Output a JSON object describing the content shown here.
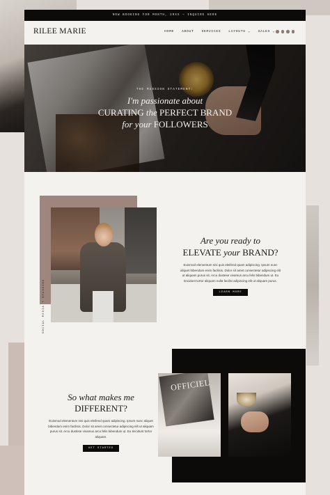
{
  "topbar": {
    "announcement": "NOW BOOKING FOR MONTH, 20XX — INQUIRE HERE"
  },
  "nav": {
    "logo": "RILEE MARIE",
    "items": [
      {
        "label": "HOME"
      },
      {
        "label": "ABOUT"
      },
      {
        "label": "SERVICES"
      },
      {
        "label": "LAYOUTS ⌄"
      },
      {
        "label": "SALES ⌄"
      }
    ],
    "social_icons": [
      "facebook-icon",
      "pinterest-icon",
      "instagram-icon",
      "heart-icon"
    ]
  },
  "hero": {
    "eyebrow": "THE MISSION STATEMENT:",
    "line1": "I'm passionate about",
    "line2_a": "CURATING ",
    "line2_b": "the",
    "line2_c": " PERFECT BRAND",
    "line3_a": "for your",
    "line3_b": " FOLLOWERS"
  },
  "about": {
    "vertical_label": "SOCIAL MEDIA + BRANDING",
    "title_a": "Are you ready to",
    "title_b": "ELEVATE ",
    "title_c": "your",
    "title_d": " BRAND?",
    "body": "Euismod elementum nisi quis eleifend quam adipiscing. Ipsum nunc aliquet bibendum enim facilisis. Dolor sit amet consectetur adipiscing elit ut aliquam purus sit. Arcu dustese vivamus arcu felis bibendum ut. Eu tincidunt tortor aliquam nulla facilisi adipiscing elit ut aliquam purus.",
    "button": "LEARN MORE"
  },
  "diff": {
    "title_a": "So what makes me",
    "title_b": "DIFFERENT?",
    "body": "Euismod elementum nisi quis eleifend quam adipiscing. Ipsum nunc aliquet bibendum enim facilisis. Dolor sit amet consectetur adipiscing elit ut aliquam purus sit. Arcu dustese vivamus arcu felis bibendum ut. Eu tincidunt tortor aliquam.",
    "button": "GET STARTED",
    "magazine_title": "OFFICIEL"
  },
  "colors": {
    "accent_tan": "#9f867c",
    "dark": "#0c0b0a",
    "page_bg": "#f4f2ef"
  }
}
